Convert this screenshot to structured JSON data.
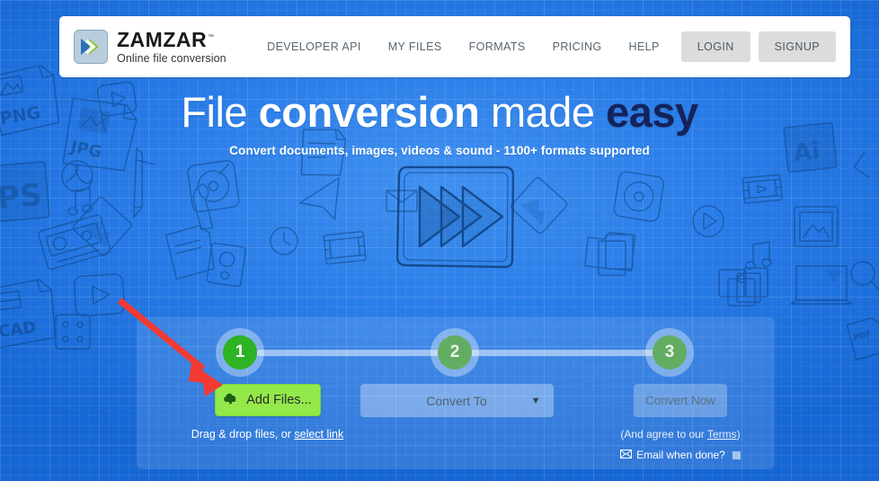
{
  "brand": {
    "name": "ZAMZAR",
    "trademark": "™",
    "tagline": "Online file conversion",
    "logo_icon": "double-chevron-icon",
    "logo_blue": "#2a6fb5",
    "logo_green": "#8cc63f"
  },
  "nav": {
    "links": [
      {
        "label": "DEVELOPER API"
      },
      {
        "label": "MY FILES"
      },
      {
        "label": "FORMATS"
      },
      {
        "label": "PRICING"
      },
      {
        "label": "HELP"
      }
    ],
    "login_label": "LOGIN",
    "signup_label": "SIGNUP"
  },
  "hero": {
    "headline_part1": "File ",
    "headline_part2": "conversion",
    "headline_part3": " made ",
    "headline_part4": "easy",
    "subheadline": "Convert documents, images, videos & sound - 1100+ formats supported",
    "graphic_icon": "play-triangles-sketch-icon"
  },
  "converter": {
    "steps": [
      {
        "number": "1",
        "state": "active"
      },
      {
        "number": "2",
        "state": "inactive"
      },
      {
        "number": "3",
        "state": "inactive"
      }
    ],
    "step1": {
      "button_label": "Add Files...",
      "button_icon": "cloud-upload-icon",
      "hint_prefix": "Drag & drop files, or ",
      "hint_link": "select link"
    },
    "step2": {
      "dropdown_value": "Convert To",
      "dropdown_icon": "chevron-down-icon"
    },
    "step3": {
      "button_label": "Convert Now",
      "terms_prefix": "(And agree to our ",
      "terms_link": "Terms",
      "terms_suffix": ")",
      "email_icon": "envelope-icon",
      "email_label": "Email when done?",
      "email_checked": false
    }
  },
  "annotation": {
    "arrow_color": "#f23a33",
    "arrow_points_to": "add-files-button"
  },
  "background": {
    "style": "blueprint-grid-with-file-format-doodles",
    "base_color": "#2a7de8",
    "doodle_labels": [
      "PNG",
      "JPG",
      "PS",
      "CAD",
      "Ai",
      "PDF"
    ]
  }
}
